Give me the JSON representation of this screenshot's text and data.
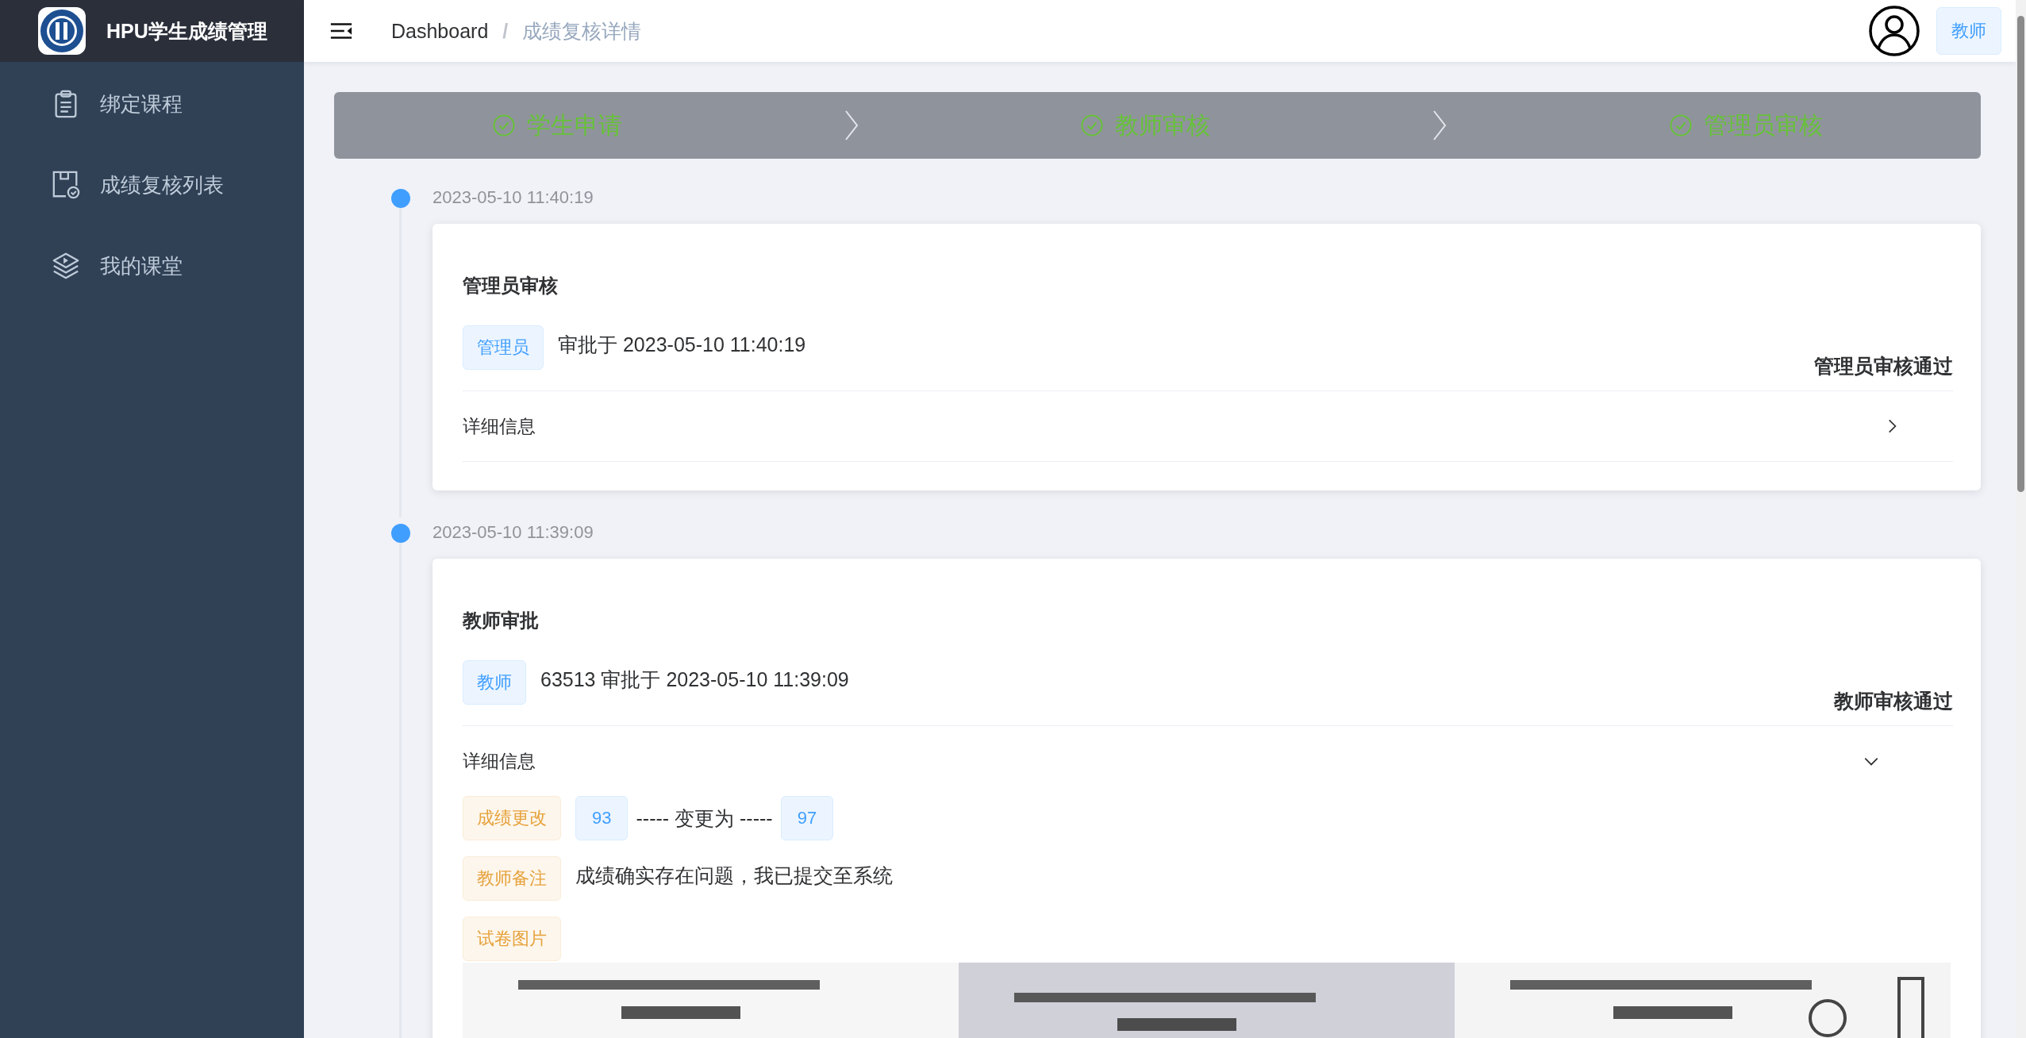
{
  "sidebar": {
    "title": "HPU学生成绩管理",
    "items": [
      {
        "label": "绑定课程",
        "kind": "clipboard",
        "selected": false
      },
      {
        "label": "成绩复核列表",
        "kind": "review",
        "selected": false
      },
      {
        "label": "我的课堂",
        "kind": "classroom",
        "selected": false
      }
    ]
  },
  "header": {
    "breadcrumb": [
      {
        "label": "Dashboard",
        "current": false
      },
      {
        "label": "成绩复核详情",
        "current": true
      }
    ],
    "separator": "/",
    "role": "教师"
  },
  "steps": [
    {
      "title": "学生申请",
      "finished": true
    },
    {
      "title": "教师审核",
      "finished": true
    },
    {
      "title": "管理员审核",
      "finished": true
    }
  ],
  "timeline": [
    {
      "timestamp": "2023-05-10 11:40:19",
      "title": "管理员审核",
      "tag": {
        "label": "管理员",
        "color": "#409eff"
      },
      "text": "审批于 2023-05-10 11:40:19",
      "result": "管理员审核通过",
      "details": {
        "title": "详细信息",
        "expanded": false
      }
    },
    {
      "timestamp": "2023-05-10 11:39:09",
      "title": "教师审批",
      "tag": {
        "label": "教师",
        "color": "#409eff"
      },
      "text": "63513 审批于 2023-05-10 11:39:09",
      "result": "教师审核通过",
      "details": {
        "title": "详细信息",
        "expanded": true,
        "rows": [
          {
            "kind": "change",
            "tag": {
              "label": "成绩更改",
              "color": "#e6a23c"
            },
            "from": {
              "label": "93",
              "color": "#409eff"
            },
            "connector": "----- 变更为 -----",
            "to": {
              "label": "97",
              "color": "#409eff"
            }
          },
          {
            "kind": "note",
            "tag": {
              "label": "教师备注",
              "color": "#e6a23c"
            },
            "text": "成绩确实存在问题，我已提交至系统"
          },
          {
            "kind": "images",
            "tag": {
              "label": "试卷图片",
              "color": "#e6a23c"
            }
          }
        ]
      }
    }
  ]
}
